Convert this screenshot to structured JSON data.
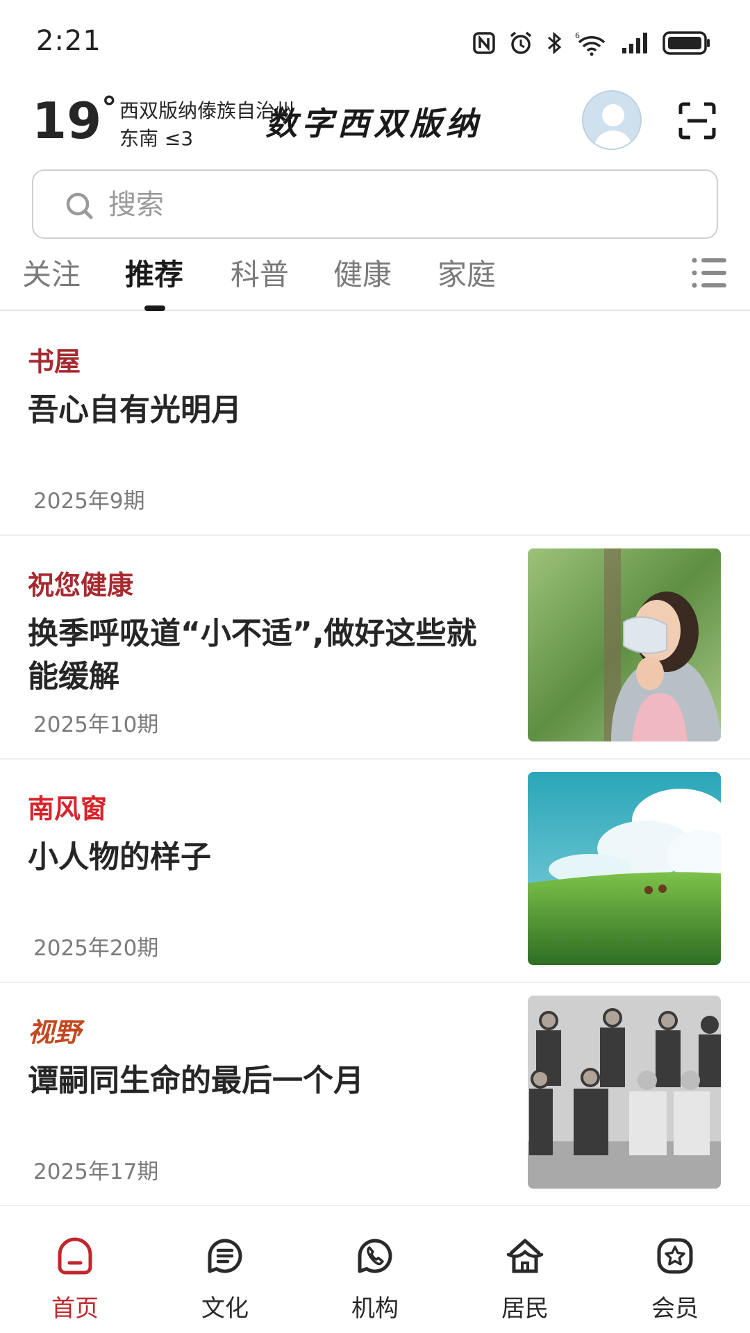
{
  "status_bar": {
    "time": "2:21",
    "icons": [
      "nfc-icon",
      "alarm-icon",
      "bluetooth-icon",
      "wifi-6-icon",
      "signal-icon",
      "battery-icon"
    ]
  },
  "header": {
    "temperature": "19",
    "degree_symbol": "°",
    "region": "西双版纳傣族自治州",
    "wind": "东南  ≤3",
    "app_logo": "数字西双版纳",
    "avatar_icon": "user-avatar-icon",
    "scan_icon": "scan-icon"
  },
  "search": {
    "placeholder": "搜索",
    "icon": "search-icon"
  },
  "tabs": {
    "items": [
      {
        "label": "关注",
        "active": false
      },
      {
        "label": "推荐",
        "active": true
      },
      {
        "label": "科普",
        "active": false
      },
      {
        "label": "健康",
        "active": false
      },
      {
        "label": "家庭",
        "active": false
      }
    ],
    "menu_icon": "list-menu-icon"
  },
  "feed": [
    {
      "source": "书屋",
      "source_color": "#a52a2f",
      "title": "吾心自有光明月",
      "issue": "2025年9期",
      "thumbnail": null
    },
    {
      "source": "祝您健康",
      "source_color": "#a52a2f",
      "title": "换季呼吸道“小不适”,做好这些就能缓解",
      "issue": "2025年10期",
      "thumbnail": "woman-wearing-mask-in-forest"
    },
    {
      "source": "南风窗",
      "source_color": "#d8232a",
      "title": "小人物的样子",
      "issue": "2025年20期",
      "thumbnail": "green-hill-with-clouds"
    },
    {
      "source": "视野",
      "source_color": "#c4481f",
      "title": "谭嗣同生命的最后一个月",
      "issue": "2025年17期",
      "thumbnail": "historical-group-photo"
    }
  ],
  "bottom_nav": {
    "items": [
      {
        "label": "首页",
        "icon": "home-icon",
        "active": true
      },
      {
        "label": "文化",
        "icon": "culture-icon",
        "active": false
      },
      {
        "label": "机构",
        "icon": "phone-icon",
        "active": false
      },
      {
        "label": "居民",
        "icon": "residents-icon",
        "active": false
      },
      {
        "label": "会员",
        "icon": "member-star-icon",
        "active": false
      }
    ],
    "active_color": "#c0272d"
  }
}
